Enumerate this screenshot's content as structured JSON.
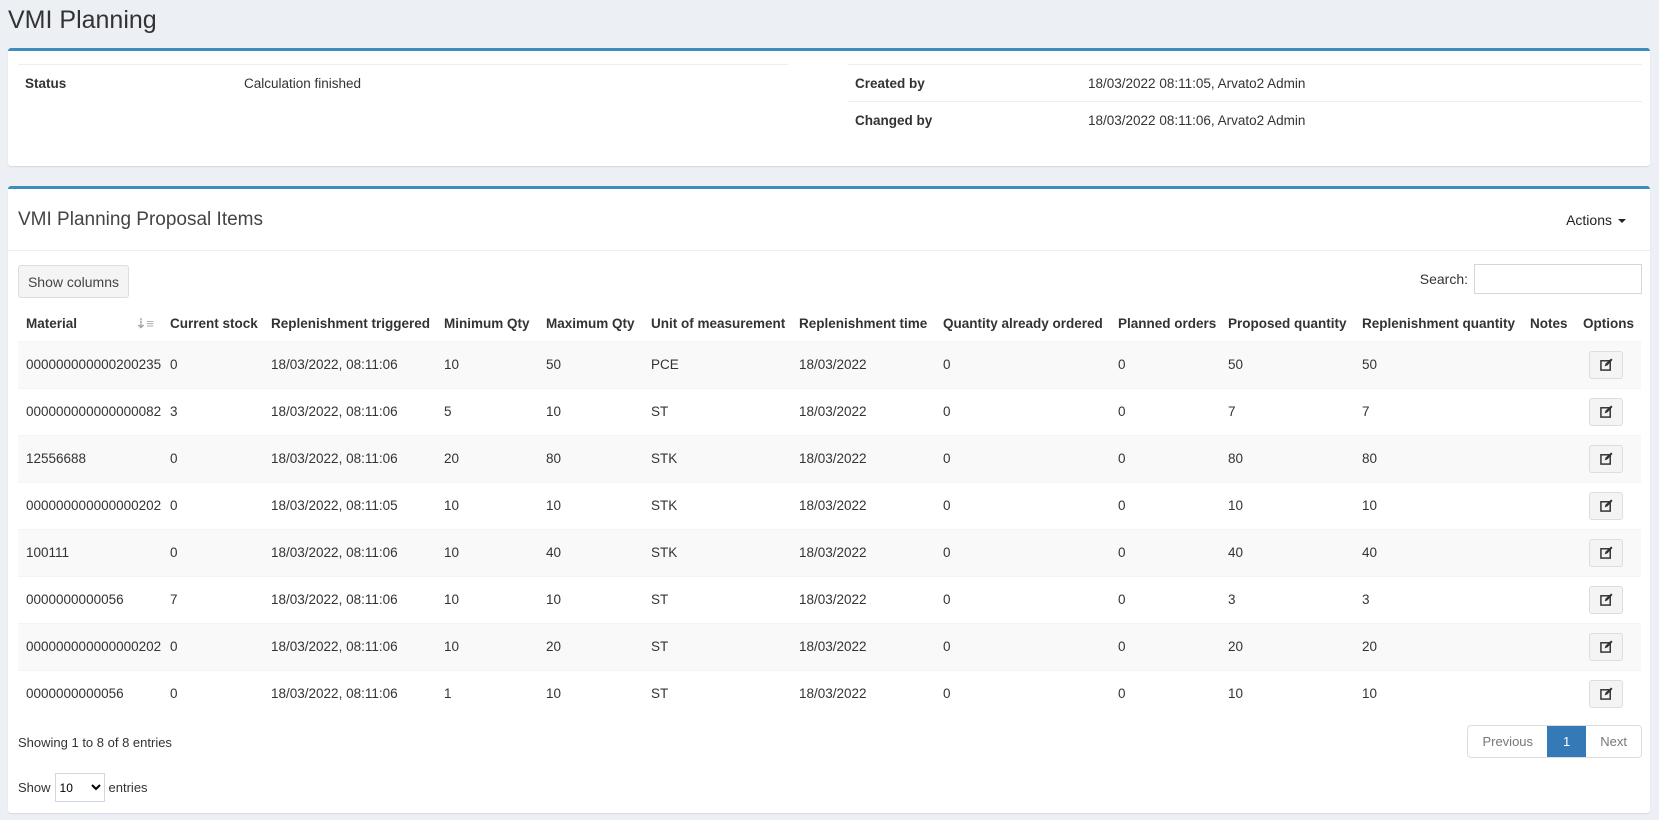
{
  "page": {
    "title": "VMI Planning"
  },
  "info": {
    "status_label": "Status",
    "status_value": "Calculation finished",
    "created_label": "Created by",
    "created_value": "18/03/2022 08:11:05, Arvato2 Admin",
    "changed_label": "Changed by",
    "changed_value": "18/03/2022 08:11:06, Arvato2 Admin"
  },
  "panel": {
    "title": "VMI Planning Proposal Items",
    "actions_label": "Actions",
    "show_columns_label": "Show columns",
    "search_label": "Search:",
    "search_value": ""
  },
  "table": {
    "columns": [
      "Material",
      "Current stock",
      "Replenishment triggered",
      "Minimum Qty",
      "Maximum Qty",
      "Unit of measurement",
      "Replenishment time",
      "Quantity already ordered",
      "Planned orders",
      "Proposed quantity",
      "Replenishment quantity",
      "Notes",
      "Options"
    ],
    "rows": [
      [
        "000000000000200235",
        "0",
        "18/03/2022, 08:11:06",
        "10",
        "50",
        "PCE",
        "18/03/2022",
        "0",
        "0",
        "50",
        "50",
        ""
      ],
      [
        "000000000000000082",
        "3",
        "18/03/2022, 08:11:06",
        "5",
        "10",
        "ST",
        "18/03/2022",
        "0",
        "0",
        "7",
        "7",
        ""
      ],
      [
        "12556688",
        "0",
        "18/03/2022, 08:11:06",
        "20",
        "80",
        "STK",
        "18/03/2022",
        "0",
        "0",
        "80",
        "80",
        ""
      ],
      [
        "000000000000000202",
        "0",
        "18/03/2022, 08:11:05",
        "10",
        "10",
        "STK",
        "18/03/2022",
        "0",
        "0",
        "10",
        "10",
        ""
      ],
      [
        "100111",
        "0",
        "18/03/2022, 08:11:06",
        "10",
        "40",
        "STK",
        "18/03/2022",
        "0",
        "0",
        "40",
        "40",
        ""
      ],
      [
        "0000000000056",
        "7",
        "18/03/2022, 08:11:06",
        "10",
        "10",
        "ST",
        "18/03/2022",
        "0",
        "0",
        "3",
        "3",
        ""
      ],
      [
        "000000000000000202",
        "0",
        "18/03/2022, 08:11:06",
        "10",
        "20",
        "ST",
        "18/03/2022",
        "0",
        "0",
        "20",
        "20",
        ""
      ],
      [
        "0000000000056",
        "0",
        "18/03/2022, 08:11:06",
        "1",
        "10",
        "ST",
        "18/03/2022",
        "0",
        "0",
        "10",
        "10",
        ""
      ]
    ]
  },
  "footer": {
    "info": "Showing 1 to 8 of 8 entries",
    "show_label": "Show",
    "entries_label": "entries",
    "page_length": "10",
    "previous": "Previous",
    "current_page": "1",
    "next": "Next"
  },
  "colors": {
    "accent": "#3c8dbc",
    "pagination_active": "#337ab7",
    "background": "#ecf0f5"
  }
}
